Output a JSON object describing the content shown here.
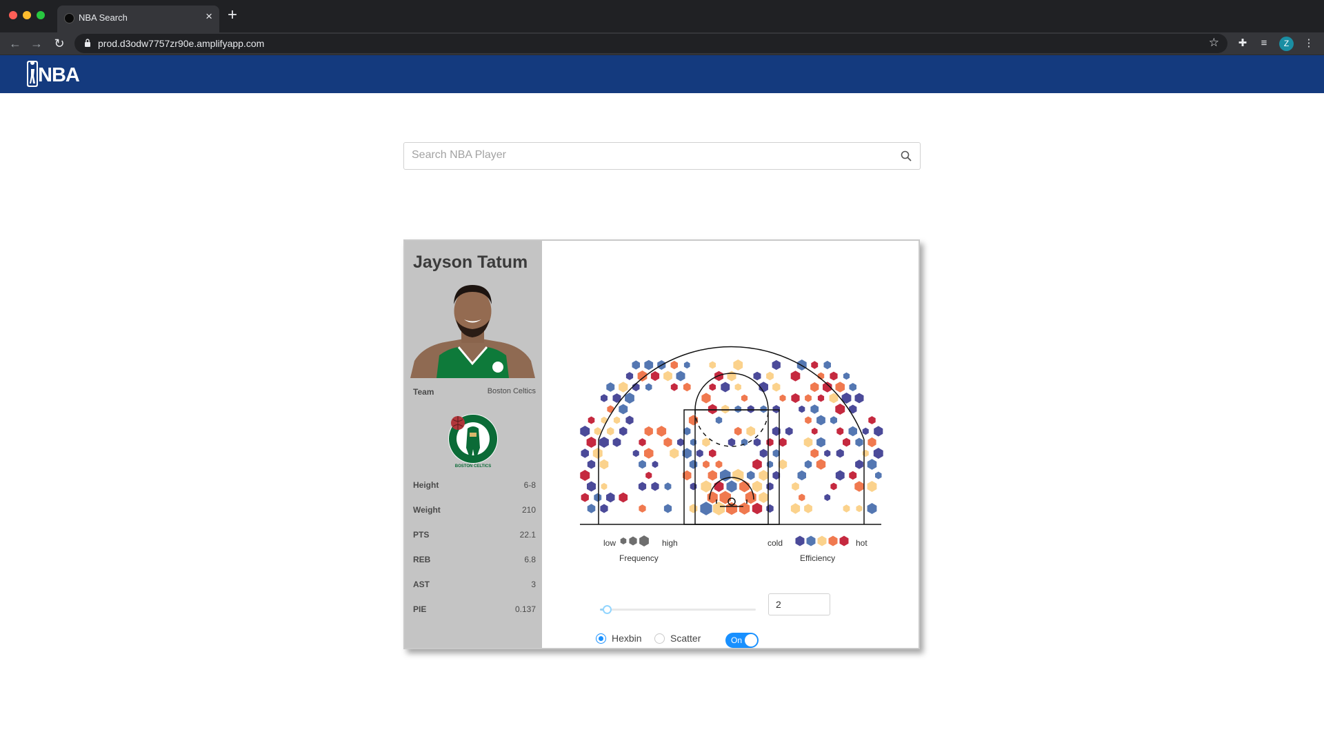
{
  "browser": {
    "tab_title": "NBA Search",
    "new_tab_icon": "+",
    "url": "prod.d3odw7757zr90e.amplifyapp.com",
    "profile_initial": "Z"
  },
  "site": {
    "logo_text": "NBA",
    "brand_color": "#143a7e"
  },
  "search": {
    "placeholder": "Search NBA Player",
    "value": ""
  },
  "player": {
    "name": "Jayson Tatum",
    "team_label": "Team",
    "team_value": "Boston Celtics",
    "team_logo_text": "BOSTON CELTICS",
    "stats": [
      {
        "label": "Height",
        "value": "6-8"
      },
      {
        "label": "Weight",
        "value": "210"
      },
      {
        "label": "PTS",
        "value": "22.1"
      },
      {
        "label": "REB",
        "value": "6.8"
      },
      {
        "label": "AST",
        "value": "3"
      },
      {
        "label": "PIE",
        "value": "0.137"
      }
    ]
  },
  "legend": {
    "frequency_low": "low",
    "frequency_high": "high",
    "frequency_title": "Frequency",
    "efficiency_cold": "cold",
    "efficiency_hot": "hot",
    "efficiency_title": "Efficiency",
    "efficiency_colors": [
      "#4b4a99",
      "#5477b2",
      "#fbd28c",
      "#f0794f",
      "#c5293f"
    ],
    "frequency_color": "#6e6e6e"
  },
  "controls": {
    "slider_value": 2,
    "slider_fraction": 0.02,
    "number_value": "2",
    "hexbin_label": "Hexbin",
    "scatter_label": "Scatter",
    "chart_mode": "Hexbin",
    "toggle_label": "On",
    "toggle_on": true,
    "accent_color": "#1890ff"
  },
  "chart_data": {
    "type": "heatmap",
    "subtype": "hexbin shot chart",
    "color_levels": [
      "#4b4a99",
      "#5477b2",
      "#fbd28c",
      "#f0794f",
      "#c5293f"
    ]
  }
}
